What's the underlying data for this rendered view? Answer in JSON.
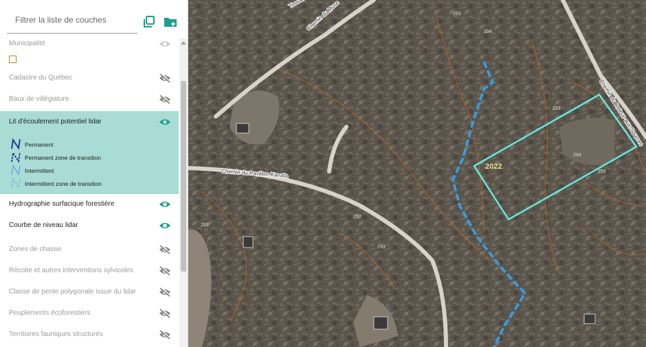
{
  "search": {
    "placeholder": "Filtrer la liste de couches"
  },
  "icons": {
    "copy": "copy-icon",
    "add_folder": "folder-add-icon",
    "eye": "eye-icon",
    "eye_off": "eye-off-icon"
  },
  "colors": {
    "accent": "#1a9e8f",
    "selected_bg": "#a9dcd5",
    "stream": "#3a9ad9",
    "parcel": "#64e8e0",
    "contour": "#b5652a"
  },
  "layers": [
    {
      "label": "Municipalité",
      "state": "partial"
    },
    {
      "label": "Cadastre du Québec",
      "state": "hidden"
    },
    {
      "label": "Baux de villégiature",
      "state": "hidden"
    },
    {
      "label": "Lit d'écoulement potentiel lidar",
      "state": "visible"
    },
    {
      "label": "Hydrographie surfacique forestière",
      "state": "visible"
    },
    {
      "label": "Courbe de niveau lidar",
      "state": "visible"
    },
    {
      "label": "Zones de chasse",
      "state": "hidden"
    },
    {
      "label": "Récolte et autres interventions sylvicoles",
      "state": "hidden"
    },
    {
      "label": "Classe de pente polygonale issue du lidar",
      "state": "hidden"
    },
    {
      "label": "Peuplements écoforestiers",
      "state": "hidden"
    },
    {
      "label": "Territoires fauniques structurés",
      "state": "hidden"
    }
  ],
  "legend": [
    {
      "label": "Permanent"
    },
    {
      "label": "Permanent zone de transition"
    },
    {
      "label": "Intermittent"
    },
    {
      "label": "Intermittent zone de transition"
    }
  ],
  "map": {
    "roads": [
      "Chemin du Muse",
      "Chemin du Pavillon-Kanata",
      "Chemin du Retour-aux-Sources",
      "Tossard"
    ],
    "contour_labels": [
      "293",
      "294",
      "293",
      "294",
      "293",
      "292",
      "293",
      "293"
    ],
    "parcel_label": "2022"
  }
}
